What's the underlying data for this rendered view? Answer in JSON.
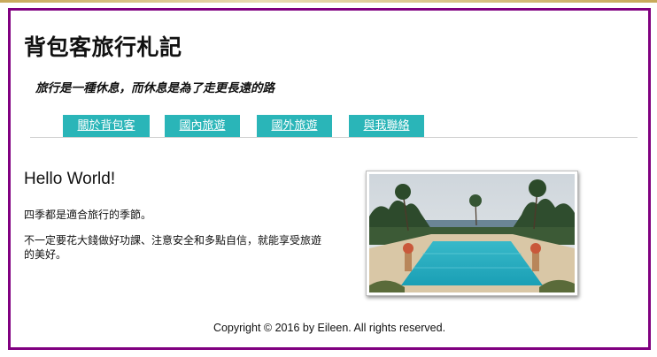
{
  "header": {
    "site_title": "背包客旅行札記",
    "tagline": "旅行是一種休息，而休息是為了走更長遠的路"
  },
  "nav": {
    "items": [
      {
        "label": "關於背包客"
      },
      {
        "label": "國內旅遊"
      },
      {
        "label": "國外旅遊"
      },
      {
        "label": "與我聯絡"
      }
    ]
  },
  "main": {
    "heading": "Hello World!",
    "paragraph_1": "四季都是適合旅行的季節。",
    "paragraph_2": "不一定要花大錢做好功課、注意安全和多點自信，就能享受旅遊的美好。"
  },
  "footer": {
    "copyright": "Copyright © 2016 by Eileen. All rights reserved."
  },
  "colors": {
    "frame_border": "#800080",
    "nav_bg": "#2ab5b8",
    "nav_text": "#ffffff"
  }
}
